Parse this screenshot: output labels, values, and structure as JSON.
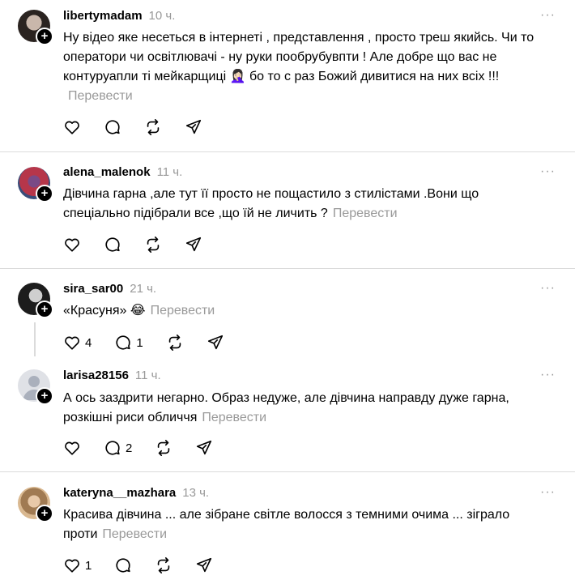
{
  "common": {
    "translate": "Перевести",
    "more": "···"
  },
  "posts": [
    {
      "username": "libertymadam",
      "time": "10 ч.",
      "text": "Ну відео яке несеться в інтернеті , представлення , просто треш якийсь. Чи то оператори чи освітлювачі - ну руки пообрубувпти ! Але добре що вас не контуруапли ті мейкарщиці 🤦🏻‍♀️ бо то с раз Божий дивитися на них всіх !!!",
      "likes": "",
      "replies": ""
    },
    {
      "username": "alena_malenok",
      "time": "11 ч.",
      "text": "Дівчина гарна ,але тут її просто не пощастило з стилістами .Вони що спеціально підібрали все ,що їй не личить ?",
      "likes": "",
      "replies": ""
    },
    {
      "username": "sira_sar00",
      "time": "21 ч.",
      "text": "«Красуня» 😂",
      "likes": "4",
      "replies": "1"
    },
    {
      "username": "larisa28156",
      "time": "11 ч.",
      "text": "А ось заздрити негарно. Образ недуже, але дівчина направду дуже гарна, розкішні риси обличчя",
      "likes": "",
      "replies": "2"
    },
    {
      "username": "kateryna__mazhara",
      "time": "13 ч.",
      "text": "Красива дівчина ... але зібране світле волосся з темними очима ... зіграло проти",
      "likes": "1",
      "replies": ""
    }
  ],
  "icons": [
    "heart-icon",
    "comment-icon",
    "repost-icon",
    "share-icon",
    "plus-icon",
    "more-icon"
  ]
}
